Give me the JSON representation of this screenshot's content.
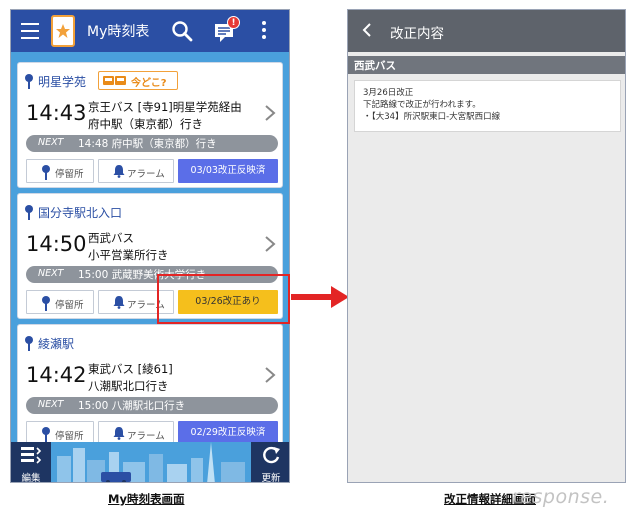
{
  "left_screen": {
    "app_title": "My時刻表",
    "notification_badge": "!",
    "cards": [
      {
        "stop_name": "明星学苑",
        "doko_label": "今どこ?",
        "time": "14:43",
        "route_line1": "京王バス [寺91]明星学苑経由",
        "route_line2": "府中駅（東京都）行き",
        "next_label": "NEXT",
        "next_text": "14:48 府中駅（東京都）行き",
        "stop_button": "停留所",
        "alarm_button": "アラーム",
        "status_button": "03/03改正反映済",
        "status_type": "reflected"
      },
      {
        "stop_name": "国分寺駅北入口",
        "doko_label": "",
        "time": "14:50",
        "route_line1": "西武バス",
        "route_line2": "小平営業所行き",
        "next_label": "NEXT",
        "next_text": "15:00 武蔵野美術大学行き",
        "stop_button": "停留所",
        "alarm_button": "アラーム",
        "status_button": "03/26改正あり",
        "status_type": "revision"
      },
      {
        "stop_name": "綾瀬駅",
        "doko_label": "",
        "time": "14:42",
        "route_line1": "東武バス [綾61]",
        "route_line2": "八潮駅北口行き",
        "next_label": "NEXT",
        "next_text": "15:00 八潮駅北口行き",
        "stop_button": "停留所",
        "alarm_button": "アラーム",
        "status_button": "02/29改正反映済",
        "status_type": "reflected"
      }
    ],
    "edit_label": "編集",
    "refresh_label": "更新",
    "caption": "My時刻表画面"
  },
  "right_screen": {
    "title": "改正内容",
    "section_title": "西武バス",
    "notice_lines": [
      "3月26日改正",
      "下記路線で改正が行われます。",
      "・【大34】所沢駅東口-大宮駅西口線"
    ],
    "caption": "改正情報詳細画面"
  },
  "watermark": "response.",
  "colors": {
    "app_bar": "#2b4fa4",
    "list_background": "#4aa0dc",
    "reflected_button": "#5b6ee8",
    "revision_button": "#f5bf1c",
    "highlight": "#e32525",
    "right_app_bar": "#5e636b"
  }
}
